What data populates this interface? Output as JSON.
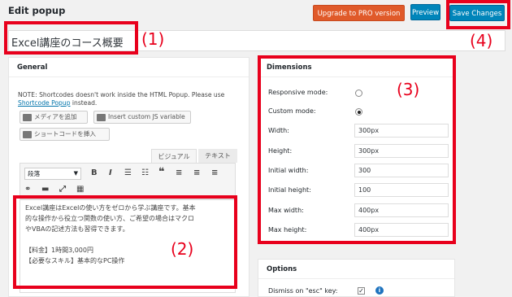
{
  "header": {
    "title": "Edit popup",
    "upgrade_label": "Upgrade to PRO version",
    "preview_label": "Preview",
    "save_label": "Save Changes"
  },
  "popup_title": "Excel講座のコース概要",
  "general": {
    "heading": "General",
    "note_prefix": "NOTE: Shortcodes doesn't work inside the HTML Popup. Please use",
    "note_link": "Shortcode Popup",
    "note_suffix": " instead.",
    "add_media": "メディアを追加",
    "insert_js": "Insert custom JS variable",
    "insert_shortcode": "ショートコードを挿入",
    "tab_visual": "ビジュアル",
    "tab_text": "テキスト",
    "format_select": "段落",
    "editor_lines": [
      "Excel講座はExcelの使い方をゼロから学ぶ講座です。基本",
      "的な操作から役立つ関数の使い方、ご希望の場合はマクロ",
      "やVBAの記述方法も習得できます。",
      "",
      "【料金】1時間3,000円",
      "【必要なスキル】基本的なPC操作"
    ]
  },
  "dimensions": {
    "heading": "Dimensions",
    "responsive_label": "Responsive mode:",
    "custom_label": "Custom mode:",
    "fields": [
      {
        "label": "Width:",
        "value": "300px"
      },
      {
        "label": "Height:",
        "value": "300px"
      },
      {
        "label": "Initial width:",
        "value": "300"
      },
      {
        "label": "Initial height:",
        "value": "100"
      },
      {
        "label": "Max width:",
        "value": "400px"
      },
      {
        "label": "Max height:",
        "value": "400px"
      }
    ]
  },
  "options": {
    "heading": "Options",
    "dismiss_label": "Dismiss on \"esc\" key:"
  },
  "annotations": {
    "n1": "(1)",
    "n2": "(2)",
    "n3": "(3)",
    "n4": "(4)"
  },
  "colors": {
    "annotation": "#e8001c",
    "upgrade": "#e05a2a",
    "primary": "#0085ba"
  }
}
